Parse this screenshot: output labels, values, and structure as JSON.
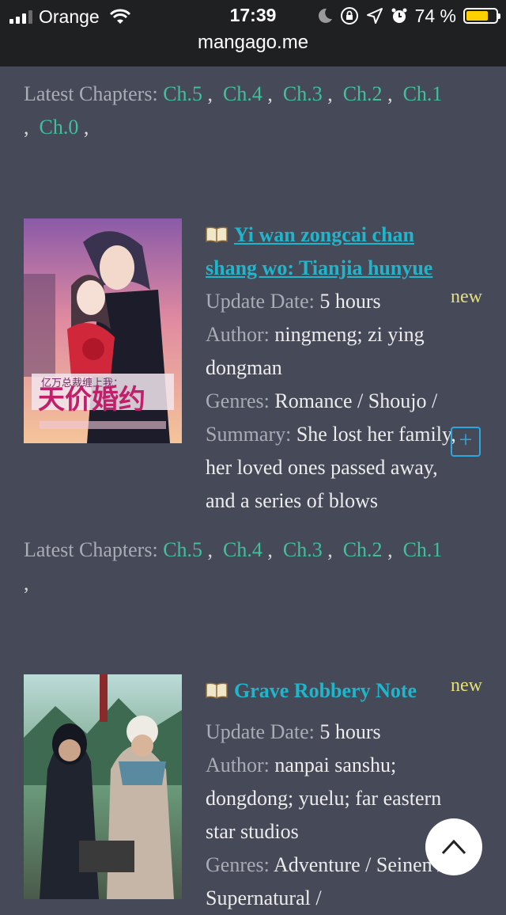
{
  "status_bar": {
    "carrier": "Orange",
    "time": "17:39",
    "battery_percent": "74 %",
    "battery_level": 0.74,
    "url": "mangago.me"
  },
  "labels": {
    "latest_chapters": "Latest Chapters:",
    "update_date": "Update Date:",
    "author": "Author:",
    "genres": "Genres:",
    "summary": "Summary:",
    "new": "new",
    "chapter_separator": " ,"
  },
  "prev_entry": {
    "chapters": [
      "Ch.5",
      "Ch.4",
      "Ch.3",
      "Ch.2",
      "Ch.1",
      "Ch.0"
    ]
  },
  "entries": [
    {
      "title_line1": "Yi wan zongcai chan",
      "title_line2": "shang wo: Tianjia hunyue",
      "update": "5 hours",
      "author_line1": "ningmeng; zi ying",
      "author_line2": "dongman",
      "genres": "Romance / Shoujo /",
      "summary_line1": "She lost her family,",
      "summary_line2": "her loved ones passed away,",
      "summary_line3": "and a series of blows",
      "chapters": [
        "Ch.5",
        "Ch.4",
        "Ch.3",
        "Ch.2",
        "Ch.1"
      ],
      "cover_text_small": "亿万总裁缠上我：",
      "cover_text_big": "天价婚约"
    },
    {
      "title": "Grave Robbery Note",
      "update": "5 hours",
      "author_line1": "nanpai sanshu;",
      "author_line2": "dongdong; yuelu; far eastern",
      "author_line3": "star studios",
      "genres": "Adventure / Seinen /",
      "genres_line2": "Supernatural /"
    }
  ]
}
